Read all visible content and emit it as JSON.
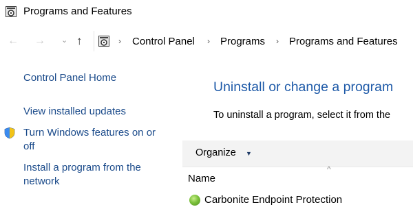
{
  "window": {
    "title": "Programs and Features"
  },
  "nav": {
    "back_icon": "arrow-left-icon",
    "forward_icon": "arrow-right-icon",
    "recent_icon": "chevron-down-icon",
    "up_icon": "arrow-up-icon",
    "separator": "›",
    "breadcrumbs": [
      "Control Panel",
      "Programs",
      "Programs and Features"
    ]
  },
  "sidebar": {
    "items": [
      {
        "label": "Control Panel Home"
      },
      {
        "label": "View installed updates"
      },
      {
        "label_line1": "Turn Windows features on or",
        "label_line2": "off",
        "icon": "uac-shield-icon"
      },
      {
        "label_line1": "Install a program from the",
        "label_line2": "network"
      }
    ]
  },
  "main": {
    "heading": "Uninstall or change a program",
    "description": "To uninstall a program, select it from the",
    "toolbar": {
      "organize_label": "Organize",
      "caret": "▼"
    },
    "sort_indicator": "^",
    "columns": [
      {
        "label": "Name"
      }
    ],
    "programs": [
      {
        "name": "Carbonite Endpoint Protection",
        "icon": "green-circle-icon"
      }
    ]
  },
  "colors": {
    "link": "#1a4a8a",
    "heading": "#1e5aa8",
    "toolbar_bg": "#f3f3f3"
  }
}
